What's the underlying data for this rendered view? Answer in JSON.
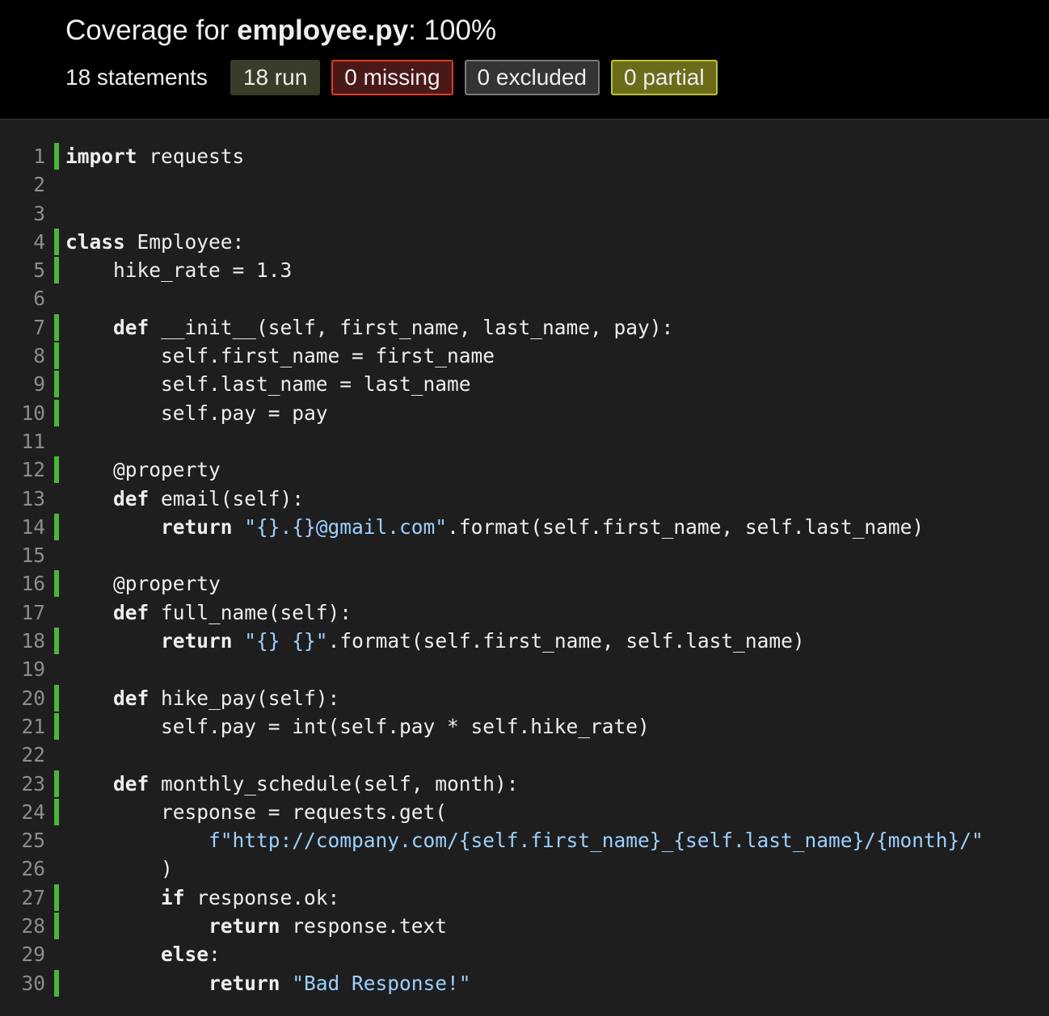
{
  "header": {
    "title_prefix": "Coverage for ",
    "file_name": "employee.py",
    "title_suffix": ": 100%",
    "statements": "18 statements",
    "badges": {
      "run": "18 run",
      "missing": "0 missing",
      "excluded": "0 excluded",
      "partial": "0 partial"
    }
  },
  "colors": {
    "run_bar": "#4ab53a",
    "string": "#9cd0ff",
    "missing_border": "#e03b2c",
    "partial_border": "#bfbf3a"
  },
  "lines": [
    {
      "n": "1",
      "run": true,
      "tokens": [
        [
          "key",
          "import"
        ],
        [
          "txt",
          " requests"
        ]
      ]
    },
    {
      "n": "2",
      "run": false,
      "tokens": []
    },
    {
      "n": "3",
      "run": false,
      "tokens": []
    },
    {
      "n": "4",
      "run": true,
      "tokens": [
        [
          "key",
          "class"
        ],
        [
          "txt",
          " Employee:"
        ]
      ]
    },
    {
      "n": "5",
      "run": true,
      "tokens": [
        [
          "txt",
          "    hike_rate = 1.3"
        ]
      ]
    },
    {
      "n": "6",
      "run": false,
      "tokens": []
    },
    {
      "n": "7",
      "run": true,
      "tokens": [
        [
          "txt",
          "    "
        ],
        [
          "key",
          "def"
        ],
        [
          "txt",
          " __init__(self, first_name, last_name, pay):"
        ]
      ]
    },
    {
      "n": "8",
      "run": true,
      "tokens": [
        [
          "txt",
          "        self.first_name = first_name"
        ]
      ]
    },
    {
      "n": "9",
      "run": true,
      "tokens": [
        [
          "txt",
          "        self.last_name = last_name"
        ]
      ]
    },
    {
      "n": "10",
      "run": true,
      "tokens": [
        [
          "txt",
          "        self.pay = pay"
        ]
      ]
    },
    {
      "n": "11",
      "run": false,
      "tokens": []
    },
    {
      "n": "12",
      "run": true,
      "tokens": [
        [
          "txt",
          "    @property"
        ]
      ]
    },
    {
      "n": "13",
      "run": false,
      "tokens": [
        [
          "txt",
          "    "
        ],
        [
          "key",
          "def"
        ],
        [
          "txt",
          " email(self):"
        ]
      ]
    },
    {
      "n": "14",
      "run": true,
      "tokens": [
        [
          "txt",
          "        "
        ],
        [
          "key",
          "return"
        ],
        [
          "txt",
          " "
        ],
        [
          "str",
          "\"{}.{}@gmail.com\""
        ],
        [
          "txt",
          ".format(self.first_name, self.last_name)"
        ]
      ]
    },
    {
      "n": "15",
      "run": false,
      "tokens": []
    },
    {
      "n": "16",
      "run": true,
      "tokens": [
        [
          "txt",
          "    @property"
        ]
      ]
    },
    {
      "n": "17",
      "run": false,
      "tokens": [
        [
          "txt",
          "    "
        ],
        [
          "key",
          "def"
        ],
        [
          "txt",
          " full_name(self):"
        ]
      ]
    },
    {
      "n": "18",
      "run": true,
      "tokens": [
        [
          "txt",
          "        "
        ],
        [
          "key",
          "return"
        ],
        [
          "txt",
          " "
        ],
        [
          "str",
          "\"{} {}\""
        ],
        [
          "txt",
          ".format(self.first_name, self.last_name)"
        ]
      ]
    },
    {
      "n": "19",
      "run": false,
      "tokens": []
    },
    {
      "n": "20",
      "run": true,
      "tokens": [
        [
          "txt",
          "    "
        ],
        [
          "key",
          "def"
        ],
        [
          "txt",
          " hike_pay(self):"
        ]
      ]
    },
    {
      "n": "21",
      "run": true,
      "tokens": [
        [
          "txt",
          "        self.pay = int(self.pay * self.hike_rate)"
        ]
      ]
    },
    {
      "n": "22",
      "run": false,
      "tokens": []
    },
    {
      "n": "23",
      "run": true,
      "tokens": [
        [
          "txt",
          "    "
        ],
        [
          "key",
          "def"
        ],
        [
          "txt",
          " monthly_schedule(self, month):"
        ]
      ]
    },
    {
      "n": "24",
      "run": true,
      "tokens": [
        [
          "txt",
          "        response = requests.get("
        ]
      ]
    },
    {
      "n": "25",
      "run": false,
      "tokens": [
        [
          "txt",
          "            "
        ],
        [
          "str",
          "f\"http://company.com/{self.first_name}_{self.last_name}/{month}/\""
        ]
      ]
    },
    {
      "n": "26",
      "run": false,
      "tokens": [
        [
          "txt",
          "        )"
        ]
      ]
    },
    {
      "n": "27",
      "run": true,
      "tokens": [
        [
          "txt",
          "        "
        ],
        [
          "key",
          "if"
        ],
        [
          "txt",
          " response.ok:"
        ]
      ]
    },
    {
      "n": "28",
      "run": true,
      "tokens": [
        [
          "txt",
          "            "
        ],
        [
          "key",
          "return"
        ],
        [
          "txt",
          " response.text"
        ]
      ]
    },
    {
      "n": "29",
      "run": false,
      "tokens": [
        [
          "txt",
          "        "
        ],
        [
          "key",
          "else"
        ],
        [
          "txt",
          ":"
        ]
      ]
    },
    {
      "n": "30",
      "run": true,
      "tokens": [
        [
          "txt",
          "            "
        ],
        [
          "key",
          "return"
        ],
        [
          "txt",
          " "
        ],
        [
          "str",
          "\"Bad Response!\""
        ]
      ]
    }
  ]
}
